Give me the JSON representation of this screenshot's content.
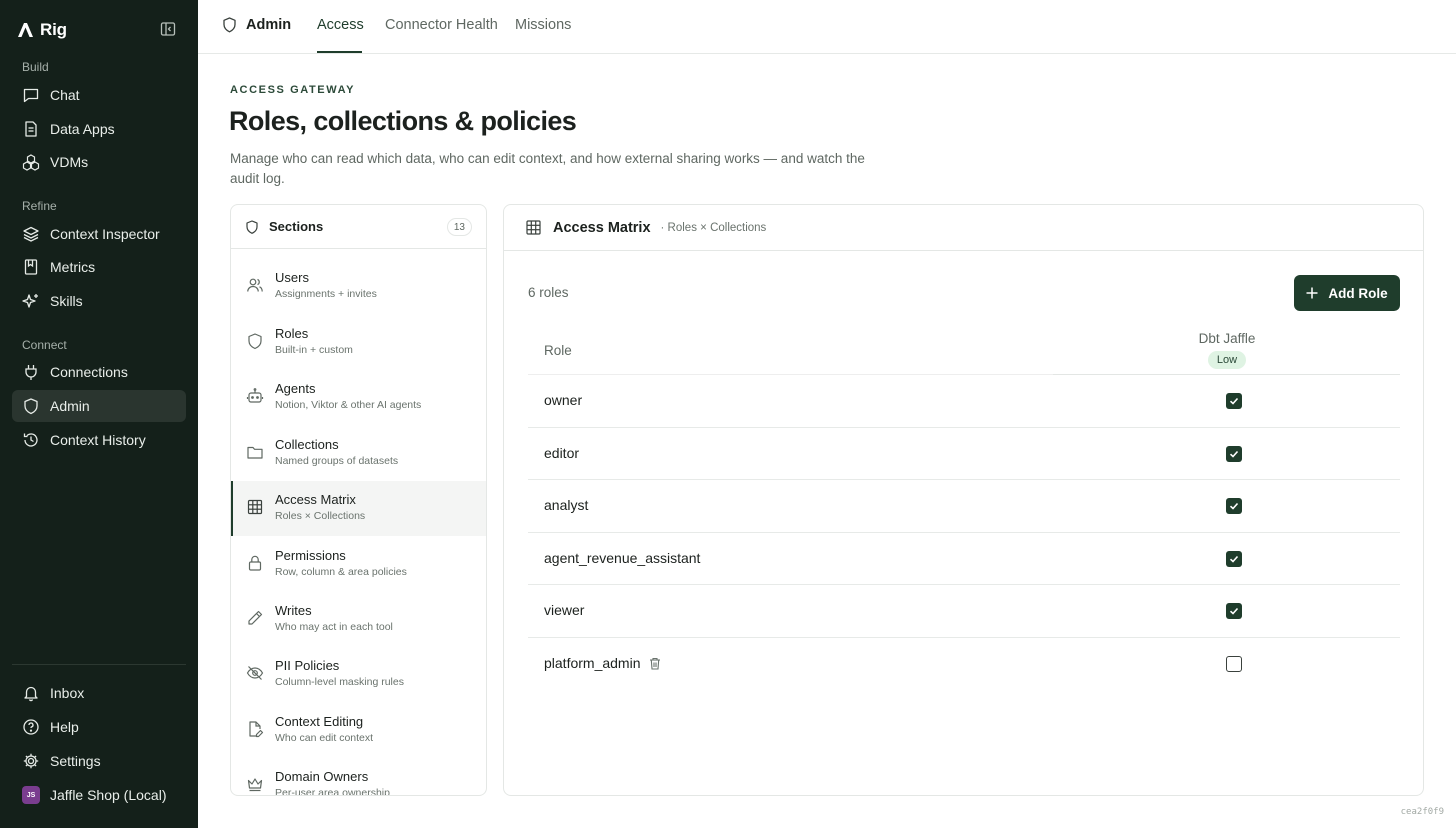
{
  "app": {
    "name": "Rig"
  },
  "sidebar": {
    "groups": [
      {
        "label": "Build",
        "items": [
          {
            "label": "Chat",
            "icon": "chat-icon"
          },
          {
            "label": "Data Apps",
            "icon": "document-icon"
          },
          {
            "label": "VDMs",
            "icon": "cubes-icon"
          }
        ]
      },
      {
        "label": "Refine",
        "items": [
          {
            "label": "Context Inspector",
            "icon": "layers-icon"
          },
          {
            "label": "Metrics",
            "icon": "book-icon"
          },
          {
            "label": "Skills",
            "icon": "sparkles-icon"
          }
        ]
      },
      {
        "label": "Connect",
        "items": [
          {
            "label": "Connections",
            "icon": "plug-icon"
          },
          {
            "label": "Admin",
            "icon": "shield-icon",
            "active": true
          },
          {
            "label": "Context History",
            "icon": "history-icon"
          }
        ]
      }
    ],
    "bottom": [
      {
        "label": "Inbox",
        "icon": "bell-icon"
      },
      {
        "label": "Help",
        "icon": "help-icon"
      },
      {
        "label": "Settings",
        "icon": "gear-icon"
      }
    ],
    "workspace": {
      "initials": "JS",
      "label": "Jaffle Shop (Local)"
    }
  },
  "topbar": {
    "title": "Admin",
    "tabs": [
      {
        "label": "Access",
        "active": true
      },
      {
        "label": "Connector Health"
      },
      {
        "label": "Missions"
      }
    ]
  },
  "header": {
    "eyebrow": "ACCESS GATEWAY",
    "title": "Roles, collections & policies",
    "description": "Manage who can read which data, who can edit context, and how external sharing works — and watch the audit log."
  },
  "sections": {
    "title": "Sections",
    "count": "13",
    "items": [
      {
        "label": "Users",
        "sub": "Assignments + invites",
        "icon": "users-icon"
      },
      {
        "label": "Roles",
        "sub": "Built-in + custom",
        "icon": "shield-icon"
      },
      {
        "label": "Agents",
        "sub": "Notion, Viktor & other AI agents",
        "icon": "bot-icon"
      },
      {
        "label": "Collections",
        "sub": "Named groups of datasets",
        "icon": "folder-icon"
      },
      {
        "label": "Access Matrix",
        "sub": "Roles × Collections",
        "icon": "grid-icon",
        "active": true
      },
      {
        "label": "Permissions",
        "sub": "Row, column & area policies",
        "icon": "lock-icon"
      },
      {
        "label": "Writes",
        "sub": "Who may act in each tool",
        "icon": "pencil-icon"
      },
      {
        "label": "PII Policies",
        "sub": "Column-level masking rules",
        "icon": "eye-off-icon"
      },
      {
        "label": "Context Editing",
        "sub": "Who can edit context",
        "icon": "file-edit-icon"
      },
      {
        "label": "Domain Owners",
        "sub": "Per-user area ownership",
        "icon": "crown-icon"
      }
    ]
  },
  "matrix": {
    "title": "Access Matrix",
    "subtitle": "· Roles × Collections",
    "roles_count": "6 roles",
    "add_label": "Add Role",
    "role_column": "Role",
    "collection": {
      "name": "Dbt Jaffle",
      "risk": "Low"
    },
    "rows": [
      {
        "role": "owner",
        "granted": true
      },
      {
        "role": "editor",
        "granted": true
      },
      {
        "role": "analyst",
        "granted": true
      },
      {
        "role": "agent_revenue_assistant",
        "granted": true
      },
      {
        "role": "viewer",
        "granted": true
      },
      {
        "role": "platform_admin",
        "granted": false,
        "deletable": true
      }
    ]
  },
  "footer": {
    "hash": "cea2f0f9"
  },
  "colors": {
    "sidebar_bg": "#14201a",
    "accent": "#1f3d2c",
    "badge_bg": "#dff3e3"
  }
}
